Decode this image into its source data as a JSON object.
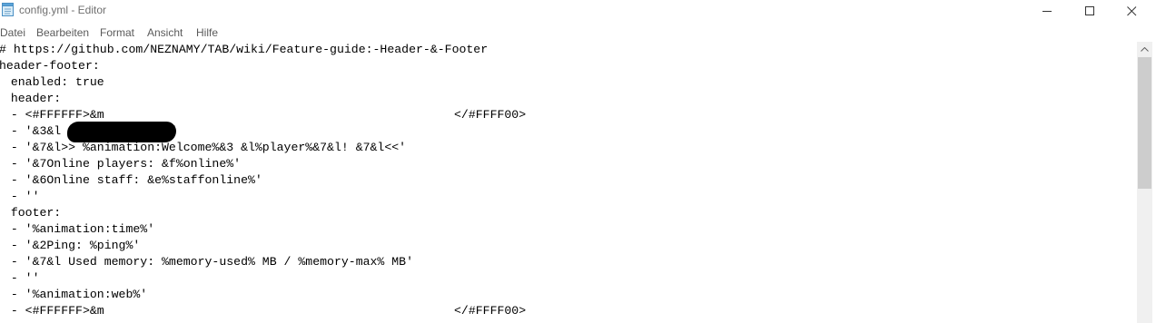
{
  "window": {
    "title": "config.yml - Editor",
    "controls": [
      "minimize",
      "maximize",
      "close"
    ]
  },
  "menu": {
    "items": [
      "Datei",
      "Bearbeiten",
      "Format",
      "Ansicht",
      "Hilfe"
    ]
  },
  "editor": {
    "lines": [
      "# https://github.com/NEZNAMY/TAB/wiki/Feature-guide:-Header-&-Footer",
      "header-footer:",
      "  enabled: true",
      "  header:",
      "  - <#FFFFFF>&m",
      "  - '&3&l",
      "  - '&7&l>> %animation:Welcome%&3 &l%player%&7&l! &7&l<<'",
      "  - '&7Online players: &f%online%'",
      "  - '&6Online staff: &e%staffonline%'",
      "  - ''",
      "  footer:",
      "  - '%animation:time%'",
      "  - '&2Ping: %ping%'",
      "  - '&7&l Used memory: %memory-used% MB / %memory-max% MB'",
      "  - ''",
      "  - '%animation:web%'",
      "  - <#FFFFFF>&m"
    ],
    "line4_suffix": "</#FFFF00>",
    "line5_suffix": "'",
    "line16_suffix": "</#FFFF00>"
  },
  "colors": {
    "background": "#ffffff",
    "text": "#000000",
    "scrollbar_track": "#f0f0f0",
    "scrollbar_thumb": "#cdcdcd"
  }
}
